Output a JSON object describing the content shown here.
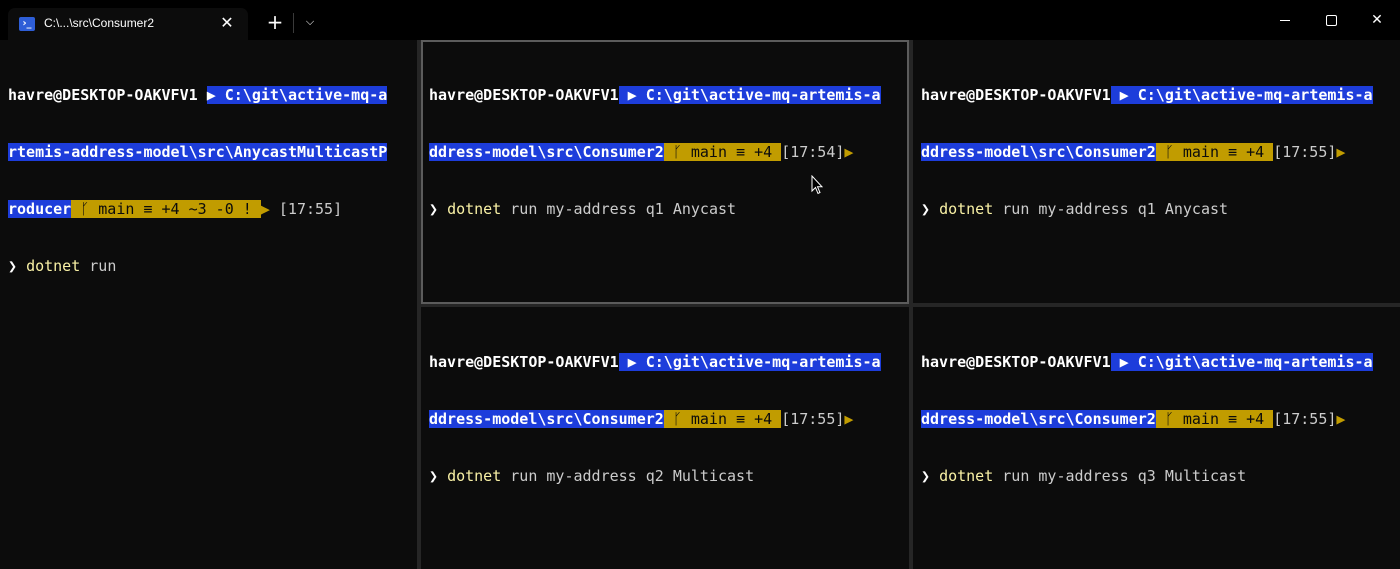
{
  "window": {
    "tab_title": "C:\\...\\src\\Consumer2",
    "tab_icon": "powershell-icon",
    "new_tab_glyph": "+",
    "dropdown_glyph": "⌵",
    "close_glyph": "✕"
  },
  "panes": [
    {
      "user": "havre@DESKTOP-OAKVFV1",
      "path_lines": [
        "C:\\git\\active-mq-a",
        "rtemis-address-model\\src\\AnycastMulticastP",
        "roducer"
      ],
      "git": " ᚴ main ≡ +4 ~3 -0 ! ",
      "time": "[17:55]",
      "prompt": "❯",
      "command": "dotnet",
      "args": " run"
    },
    {
      "user": "havre@DESKTOP-OAKVFV1",
      "path_lines": [
        "C:\\git\\active-mq-artemis-a",
        "ddress-model\\src\\Consumer2"
      ],
      "git": " ᚴ main ≡ +4 ",
      "time": "[17:54]",
      "prompt": "❯",
      "command": "dotnet",
      "args": " run my-address q1 Anycast"
    },
    {
      "user": "havre@DESKTOP-OAKVFV1",
      "path_lines": [
        "C:\\git\\active-mq-artemis-a",
        "ddress-model\\src\\Consumer2"
      ],
      "git": " ᚴ main ≡ +4 ",
      "time": "[17:55]",
      "prompt": "❯",
      "command": "dotnet",
      "args": " run my-address q1 Anycast"
    },
    {
      "user": "havre@DESKTOP-OAKVFV1",
      "path_lines": [
        "C:\\git\\active-mq-artemis-a",
        "ddress-model\\src\\Consumer2"
      ],
      "git": " ᚴ main ≡ +4 ",
      "time": "[17:55]",
      "prompt": "❯",
      "command": "dotnet",
      "args": " run my-address q2 Multicast"
    },
    {
      "user": "havre@DESKTOP-OAKVFV1",
      "path_lines": [
        "C:\\git\\active-mq-artemis-a",
        "ddress-model\\src\\Consumer2"
      ],
      "git": " ᚴ main ≡ +4 ",
      "time": "[17:55]",
      "prompt": "❯",
      "command": "dotnet",
      "args": " run my-address q3 Multicast"
    }
  ],
  "colors": {
    "background": "#0c0c0c",
    "path_segment": "#1d3ddb",
    "git_segment": "#c19c00",
    "command": "#f9f1a5"
  }
}
